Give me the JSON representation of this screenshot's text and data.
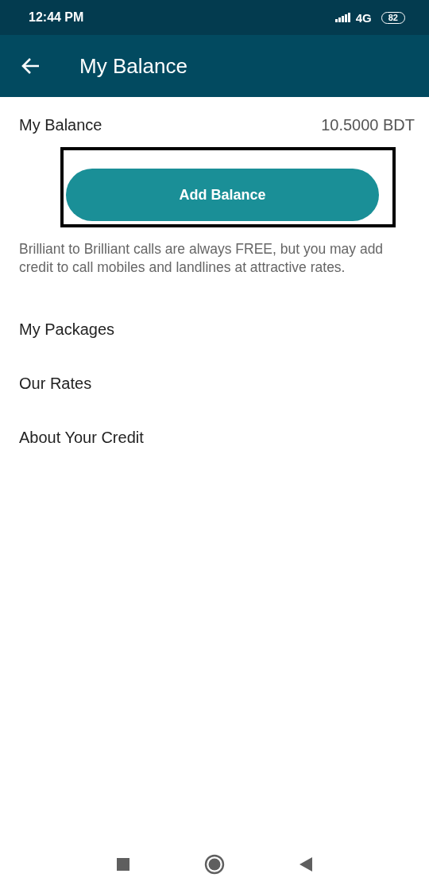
{
  "status_bar": {
    "time": "12:44 PM",
    "network": "4G",
    "battery": "82"
  },
  "app_bar": {
    "title": "My Balance"
  },
  "balance": {
    "label": "My Balance",
    "value": "10.5000 BDT"
  },
  "add_button": {
    "label": "Add Balance",
    "highlighted": true
  },
  "note": "Brilliant to Brilliant calls are always FREE, but you may add credit to call mobiles and landlines at attractive rates.",
  "menu": [
    {
      "label": "My Packages"
    },
    {
      "label": "Our Rates"
    },
    {
      "label": "About Your Credit"
    }
  ]
}
